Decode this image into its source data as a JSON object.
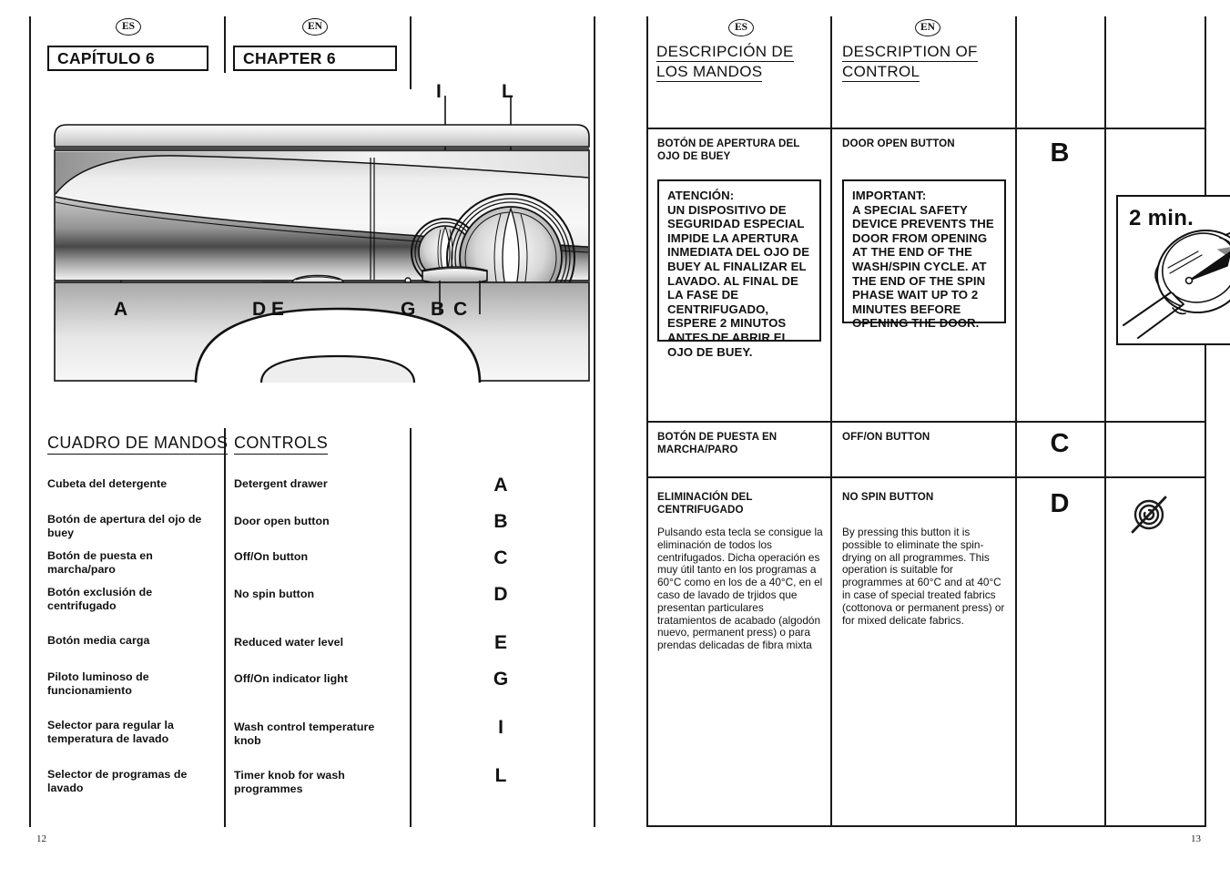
{
  "spread": {
    "left_page_number": "12",
    "right_page_number": "13"
  },
  "badges": {
    "es": "ES",
    "en": "EN"
  },
  "left_page": {
    "chapter_es": "CAPÍTULO 6",
    "chapter_en": "CHAPTER 6",
    "diagram": {
      "name": "washing-machine-control-panel",
      "callouts": [
        "A",
        "D",
        "E",
        "G",
        "B",
        "C",
        "I",
        "L"
      ]
    },
    "table_heading_es": "CUADRO DE MANDOS",
    "table_heading_en": "CONTROLS",
    "controls": [
      {
        "letter": "A",
        "es": "Cubeta del detergente",
        "en": "Detergent drawer"
      },
      {
        "letter": "B",
        "es": "Botón de apertura del ojo de buey",
        "en": "Door open button"
      },
      {
        "letter": "C",
        "es": "Botón de puesta en marcha/paro",
        "en": "Off/On button"
      },
      {
        "letter": "D",
        "es": "Botón exclusión de centrifugado",
        "en": "No spin button"
      },
      {
        "letter": "E",
        "es": "Botón media carga",
        "en": "Reduced water level"
      },
      {
        "letter": "G",
        "es": "Piloto luminoso de funcionamiento",
        "en": "Off/On indicator light"
      },
      {
        "letter": "I",
        "es": "Selector para regular la temperatura de lavado",
        "en": "Wash control temperature knob"
      },
      {
        "letter": "L",
        "es": "Selector de programas de lavado",
        "en": "Timer knob for wash programmes"
      }
    ]
  },
  "right_page": {
    "heading_es_line1": "DESCRIPCIÓN DE",
    "heading_es_line2": "LOS MANDOS",
    "heading_en_line1": "DESCRIPTION OF",
    "heading_en_line2": "CONTROL",
    "rows": [
      {
        "letter": "B",
        "title_es": "BOTÓN DE APERTURA DEL OJO DE BUEY",
        "title_en": "DOOR OPEN BUTTON",
        "warn_es": "ATENCIÓN:\nUN DISPOSITIVO DE SEGURIDAD ESPECIAL IMPIDE LA APERTURA INMEDIATA DEL OJO DE BUEY AL FINALIZAR EL LAVADO. AL FINAL DE LA FASE DE CENTRIFUGADO, ESPERE 2 MINUTOS ANTES DE ABRIR EL OJO DE BUEY.",
        "warn_en": "IMPORTANT:\nA SPECIAL SAFETY DEVICE PREVENTS THE DOOR FROM OPENING AT THE END OF THE WASH/SPIN CYCLE. AT THE END OF THE SPIN PHASE WAIT UP TO 2 MINUTES BEFORE OPENING THE DOOR.",
        "figure": "wristwatch-2-min",
        "figure_label": "2 min."
      },
      {
        "letter": "C",
        "title_es": "BOTÓN DE PUESTA EN MARCHA/PARO",
        "title_en": "OFF/ON BUTTON",
        "body_es": "",
        "body_en": "",
        "figure": ""
      },
      {
        "letter": "D",
        "title_es": "ELIMINACIÓN DEL CENTRIFUGADO",
        "title_en": "NO SPIN BUTTON",
        "body_es": "Pulsando esta tecla se consigue la eliminación de todos los centrifugados. Dicha operación es muy útil tanto en los programas a 60°C como en los de a 40°C, en el caso de lavado de trjidos que presentan particulares tratamientos de acabado (algodón nuevo, permanent press) o para prendas delicadas de fibra mixta",
        "body_en": "By pressing this button it is possible to eliminate the spin-drying on all programmes. This operation is suitable for programmes at 60°C and at 40°C in case of special treated fabrics (cottonova or permanent press) or for mixed delicate fabrics.",
        "figure": "no-spin-icon"
      }
    ]
  },
  "colors": {
    "ink": "#111111",
    "panel_light": "#ffffff",
    "panel_dark": "#4a4a4a"
  }
}
